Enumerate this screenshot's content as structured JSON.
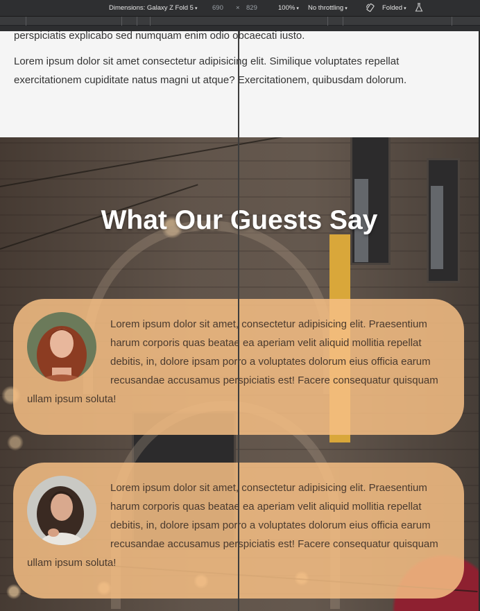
{
  "devtools": {
    "dimensions_label": "Dimensions: Galaxy Z Fold 5",
    "width_value": "690",
    "times": "×",
    "height_value": "829",
    "zoom": "100%",
    "throttling": "No throttling",
    "posture": "Folded",
    "caret": "▾"
  },
  "page": {
    "paragraph_1": "perspiciatis explicabo sed numquam enim odio obcaecati iusto.",
    "paragraph_2": "Lorem ipsum dolor sit amet consectetur adipisicing elit. Similique voluptates repellat exercitationem cupiditate natus magni ut atque? Exercitationem, quibusdam dolorum.",
    "testimonials_title": "What Our Guests Say",
    "testimonials": [
      {
        "avatar_icon": "woman-red-hair-avatar",
        "text": "Lorem ipsum dolor sit amet, consectetur adipisicing elit. Praesentium harum corporis quas beatae ea aperiam velit aliquid mollitia repellat debitis, in, dolore ipsam porro a voluptates dolorum eius officia earum recusandae accusamus perspiciatis est! Facere consequatur quisquam ullam ipsum soluta!"
      },
      {
        "avatar_icon": "woman-dark-hair-avatar",
        "text": "Lorem ipsum dolor sit amet, consectetur adipisicing elit. Praesentium harum corporis quas beatae ea aperiam velit aliquid mollitia repellat debitis, in, dolore ipsam porro a voluptates dolorum eius officia earum recusandae accusamus perspiciatis est! Facere consequatur quisquam ullam ipsum soluta!"
      }
    ]
  },
  "colors": {
    "card_background": "#f5be84",
    "title_text": "#ffffff",
    "body_text": "#333333"
  }
}
